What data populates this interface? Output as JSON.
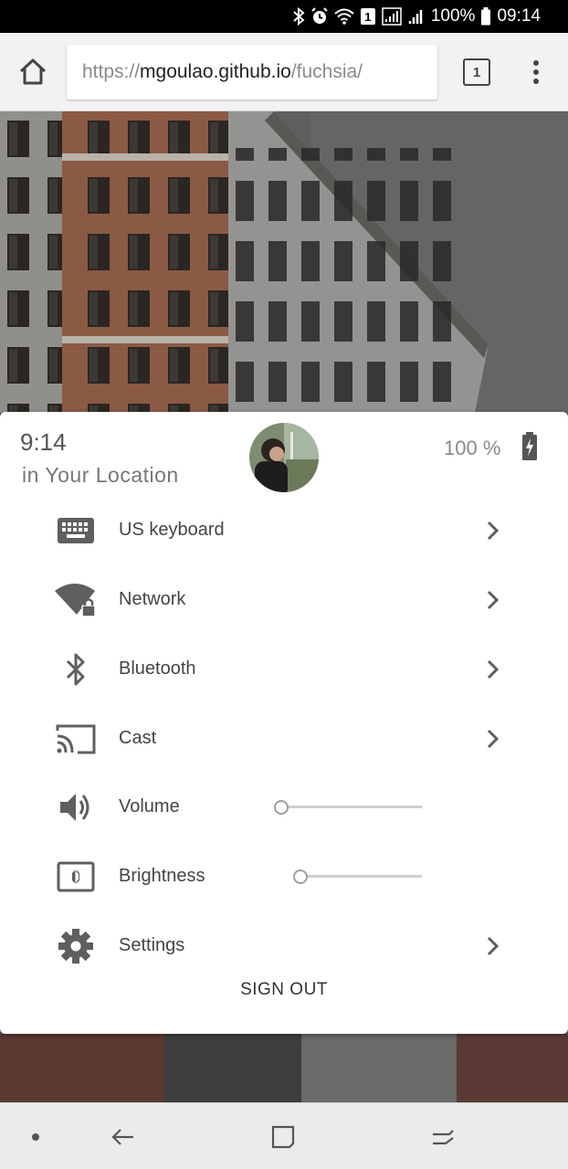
{
  "status_bar": {
    "battery_text": "100%",
    "time": "09:14",
    "notification_badge": "1",
    "icons": [
      "bluetooth-icon",
      "alarm-icon",
      "wifi-icon",
      "notification-badge-icon",
      "signal-icon",
      "signal-icon",
      "battery-icon"
    ]
  },
  "browser": {
    "url_prefix": "https://",
    "url_host": "mgoulao.github.io",
    "url_path": "/fuchsia/",
    "tab_count": "1",
    "icons": [
      "home-icon",
      "tabs-icon",
      "overflow-menu-icon"
    ]
  },
  "panel": {
    "time": "9:14",
    "location": "in Your Location",
    "battery_text": "100 %",
    "items": [
      {
        "label": "US keyboard",
        "icon": "keyboard-icon",
        "has_chevron": true
      },
      {
        "label": "Network",
        "icon": "wifi-lock-icon",
        "has_chevron": true
      },
      {
        "label": "Bluetooth",
        "icon": "bluetooth-icon",
        "has_chevron": true
      },
      {
        "label": "Cast",
        "icon": "cast-icon",
        "has_chevron": true
      },
      {
        "label": "Volume",
        "icon": "volume-icon",
        "slider_value": 0
      },
      {
        "label": "Brightness",
        "icon": "brightness-icon",
        "slider_value": 0
      },
      {
        "label": "Settings",
        "icon": "gear-icon",
        "has_chevron": true
      }
    ],
    "sign_out": "SIGN OUT"
  },
  "nav_bar": {
    "icons": [
      "dot-icon",
      "back-icon",
      "home-square-icon",
      "recents-icon"
    ]
  },
  "colors": {
    "panel_bg": "#ffffff",
    "text": "#444444",
    "chrome_bg": "#f2f2f2"
  }
}
